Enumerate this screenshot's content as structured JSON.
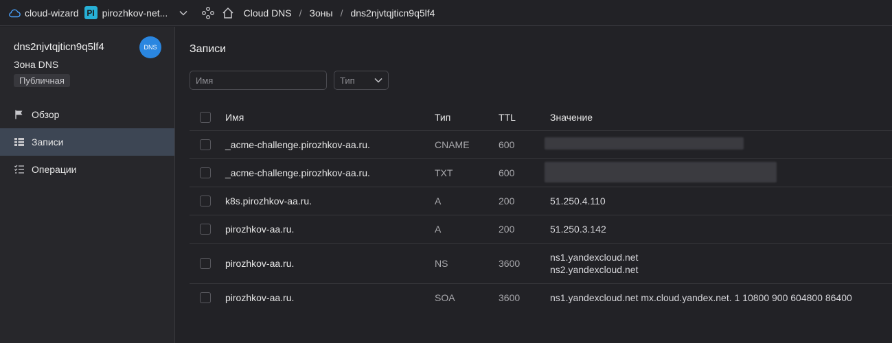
{
  "topbar": {
    "cloud_name": "cloud-wizard",
    "folder_badge": "PI",
    "folder_name": "pirozhkov-net...",
    "breadcrumbs": [
      "Cloud DNS",
      "Зоны",
      "dns2njvtqjticn9q5lf4"
    ],
    "separator": "/"
  },
  "sidebar": {
    "zone_title": "dns2njvtqjticn9q5lf4",
    "zone_type": "Зона DNS",
    "visibility_badge": "Публичная",
    "avatar_text": "DNS",
    "items": [
      {
        "label": "Обзор",
        "icon": "flag-icon",
        "active": false
      },
      {
        "label": "Записи",
        "icon": "records-list-icon",
        "active": true
      },
      {
        "label": "Операции",
        "icon": "operations-list-icon",
        "active": false
      }
    ]
  },
  "main": {
    "title": "Записи",
    "search_placeholder": "Имя",
    "type_select": "Тип",
    "columns": {
      "name": "Имя",
      "type": "Тип",
      "ttl": "TTL",
      "value": "Значение"
    },
    "rows": [
      {
        "name": "_acme-challenge.pirozhkov-aa.ru.",
        "type": "CNAME",
        "ttl": "600",
        "value": [
          "[redacted]"
        ]
      },
      {
        "name": "_acme-challenge.pirozhkov-aa.ru.",
        "type": "TXT",
        "ttl": "600",
        "value": [
          "[redacted]"
        ]
      },
      {
        "name": "k8s.pirozhkov-aa.ru.",
        "type": "A",
        "ttl": "200",
        "value": [
          "51.250.4.110"
        ]
      },
      {
        "name": "pirozhkov-aa.ru.",
        "type": "A",
        "ttl": "200",
        "value": [
          "51.250.3.142"
        ]
      },
      {
        "name": "pirozhkov-aa.ru.",
        "type": "NS",
        "ttl": "3600",
        "value": [
          "ns1.yandexcloud.net",
          "ns2.yandexcloud.net"
        ]
      },
      {
        "name": "pirozhkov-aa.ru.",
        "type": "SOA",
        "ttl": "3600",
        "value": [
          "ns1.yandexcloud.net mx.cloud.yandex.net. 1 10800 900 604800 86400"
        ]
      }
    ]
  }
}
